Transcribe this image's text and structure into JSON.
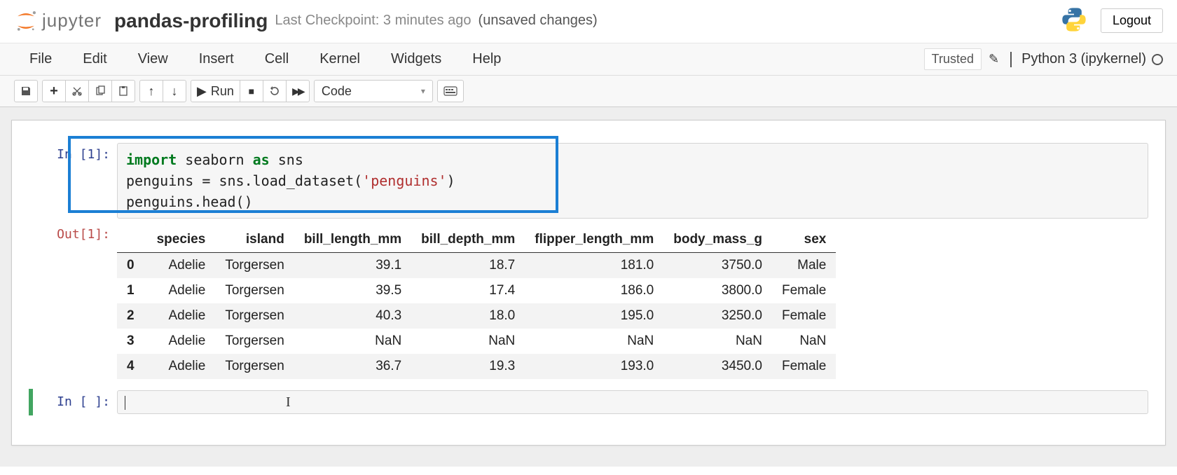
{
  "header": {
    "logo_text": "jupyter",
    "title": "pandas-profiling",
    "checkpoint": "Last Checkpoint: 3 minutes ago",
    "unsaved": "(unsaved changes)",
    "logout": "Logout"
  },
  "menu": {
    "items": [
      "File",
      "Edit",
      "View",
      "Insert",
      "Cell",
      "Kernel",
      "Widgets",
      "Help"
    ],
    "trusted": "Trusted",
    "kernel": "Python 3 (ipykernel)"
  },
  "toolbar": {
    "run": "Run",
    "cell_type": "Code"
  },
  "cells": [
    {
      "in_prompt": "In [1]:",
      "code_tokens": [
        {
          "t": "import",
          "c": "kw"
        },
        {
          "t": " seaborn "
        },
        {
          "t": "as",
          "c": "kw"
        },
        {
          "t": " sns\n"
        },
        {
          "t": "penguins = sns.load_dataset("
        },
        {
          "t": "'penguins'",
          "c": "str"
        },
        {
          "t": ")\n"
        },
        {
          "t": "penguins.head()"
        }
      ],
      "out_prompt": "Out[1]:",
      "table": {
        "columns": [
          "",
          "species",
          "island",
          "bill_length_mm",
          "bill_depth_mm",
          "flipper_length_mm",
          "body_mass_g",
          "sex"
        ],
        "rows": [
          [
            "0",
            "Adelie",
            "Torgersen",
            "39.1",
            "18.7",
            "181.0",
            "3750.0",
            "Male"
          ],
          [
            "1",
            "Adelie",
            "Torgersen",
            "39.5",
            "17.4",
            "186.0",
            "3800.0",
            "Female"
          ],
          [
            "2",
            "Adelie",
            "Torgersen",
            "40.3",
            "18.0",
            "195.0",
            "3250.0",
            "Female"
          ],
          [
            "3",
            "Adelie",
            "Torgersen",
            "NaN",
            "NaN",
            "NaN",
            "NaN",
            "NaN"
          ],
          [
            "4",
            "Adelie",
            "Torgersen",
            "36.7",
            "19.3",
            "193.0",
            "3450.0",
            "Female"
          ]
        ]
      }
    },
    {
      "in_prompt": "In [ ]:"
    }
  ]
}
